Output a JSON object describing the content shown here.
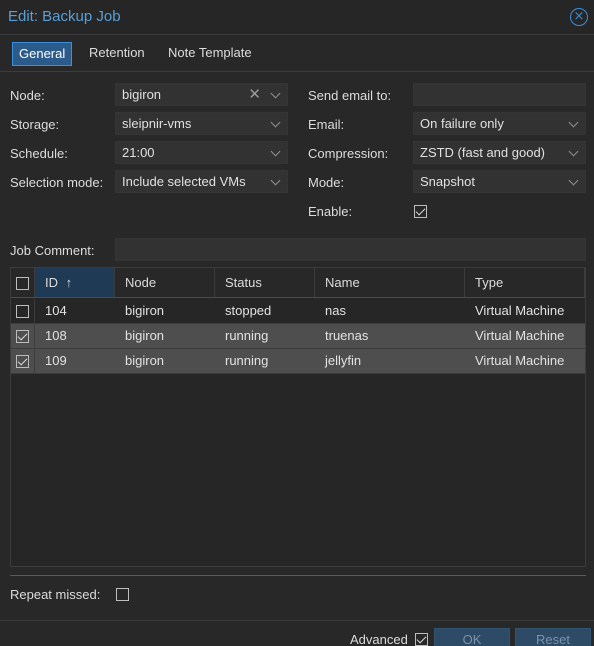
{
  "window": {
    "title": "Edit: Backup Job",
    "close_icon": "⨯"
  },
  "tabs": [
    {
      "label": "General",
      "active": true
    },
    {
      "label": "Retention",
      "active": false
    },
    {
      "label": "Note Template",
      "active": false
    }
  ],
  "form": {
    "node_label": "Node:",
    "node_value": "bigiron",
    "node_clear": "✕",
    "storage_label": "Storage:",
    "storage_value": "sleipnir-vms",
    "schedule_label": "Schedule:",
    "schedule_value": "21:00",
    "selection_label": "Selection mode:",
    "selection_value": "Include selected VMs",
    "sendemail_label": "Send email to:",
    "sendemail_value": "",
    "email_label": "Email:",
    "email_value": "On failure only",
    "compression_label": "Compression:",
    "compression_value": "ZSTD (fast and good)",
    "mode_label": "Mode:",
    "mode_value": "Snapshot",
    "enable_label": "Enable:",
    "enable_checked": true,
    "comment_label": "Job Comment:",
    "comment_value": ""
  },
  "grid": {
    "headers": {
      "id": "ID",
      "sort_icon": "↑",
      "node": "Node",
      "status": "Status",
      "name": "Name",
      "type": "Type"
    },
    "rows": [
      {
        "checked": false,
        "id": "104",
        "node": "bigiron",
        "status": "stopped",
        "name": "nas",
        "type": "Virtual Machine"
      },
      {
        "checked": true,
        "id": "108",
        "node": "bigiron",
        "status": "running",
        "name": "truenas",
        "type": "Virtual Machine"
      },
      {
        "checked": true,
        "id": "109",
        "node": "bigiron",
        "status": "running",
        "name": "jellyfin",
        "type": "Virtual Machine"
      }
    ]
  },
  "repeat_missed_label": "Repeat missed:",
  "footer": {
    "advanced_label": "Advanced",
    "ok_label": "OK",
    "reset_label": "Reset"
  }
}
